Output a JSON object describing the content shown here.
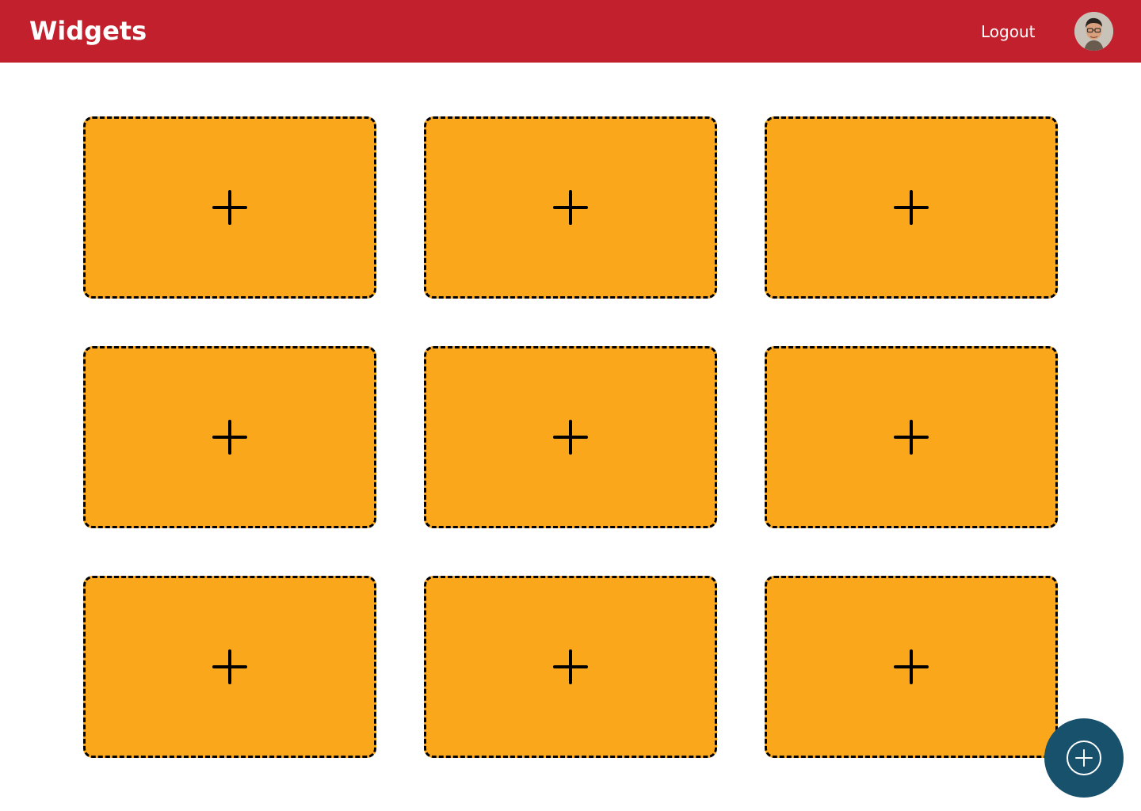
{
  "header": {
    "title": "Widgets",
    "logout_label": "Logout",
    "avatar": {
      "icon": "user-avatar"
    }
  },
  "widgets": [
    {
      "icon": "plus-icon",
      "action": "add-widget"
    },
    {
      "icon": "plus-icon",
      "action": "add-widget"
    },
    {
      "icon": "plus-icon",
      "action": "add-widget"
    },
    {
      "icon": "plus-icon",
      "action": "add-widget"
    },
    {
      "icon": "plus-icon",
      "action": "add-widget"
    },
    {
      "icon": "plus-icon",
      "action": "add-widget"
    },
    {
      "icon": "plus-icon",
      "action": "add-widget"
    },
    {
      "icon": "plus-icon",
      "action": "add-widget"
    },
    {
      "icon": "plus-icon",
      "action": "add-widget"
    }
  ],
  "fab": {
    "icon": "plus-circle-icon"
  },
  "colors": {
    "header": "#C3202E",
    "widget_fill": "#FAA71C",
    "widget_border": "#000000",
    "fab": "#17516B",
    "text_on_header": "#FFFFFF"
  }
}
